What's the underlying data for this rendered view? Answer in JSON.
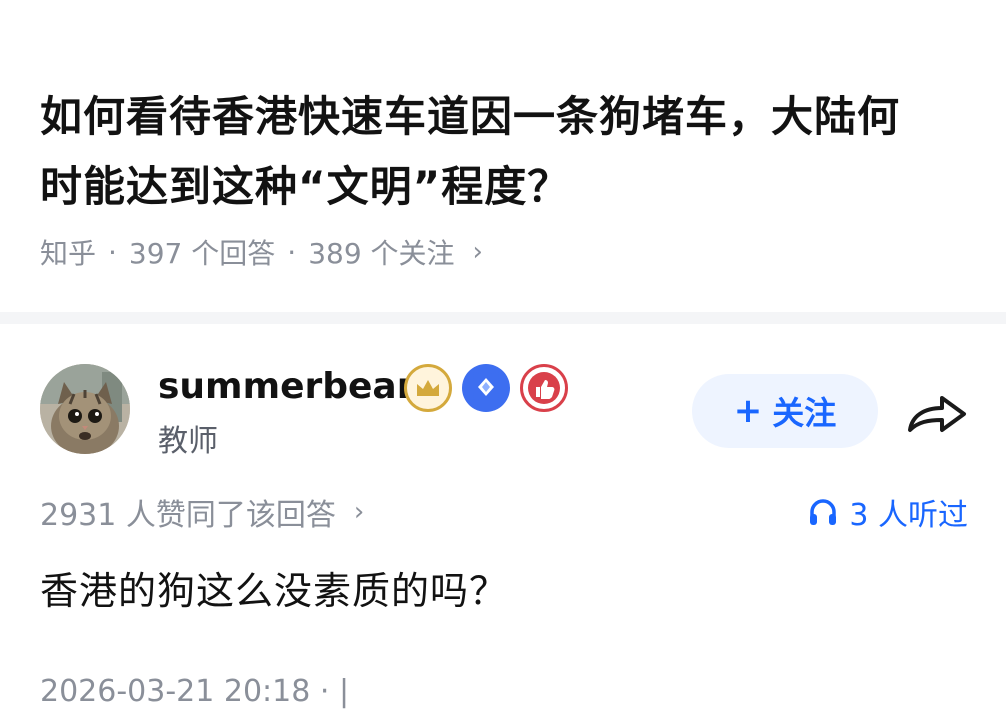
{
  "question": {
    "title": "如何看待香港快速车道因一条狗堵车，大陆何时能达到这种“文明”程度？",
    "source": "知乎",
    "separator": "·",
    "answers_count": "397 个回答",
    "followers_count": "389 个关注",
    "chevron": "›"
  },
  "answer": {
    "author": {
      "name": "summerbear",
      "title": "教师",
      "avatar_icon": "cat-avatar-icon",
      "badges": [
        "crown-badge-icon",
        "diamond-badge-icon",
        "thumbs-up-badge-icon"
      ]
    },
    "follow_button": {
      "plus": "+",
      "label": "关注"
    },
    "share_icon": "share-arrow-icon",
    "upvotes": "2931 人赞同了该回答",
    "upvotes_chevron": "›",
    "listen": {
      "icon": "headphones-icon",
      "label": "3 人听过"
    },
    "content": "香港的狗这么没素质的吗？",
    "timestamp": "2026-03-21 20:18 · |"
  },
  "colors": {
    "accent": "#1966ff",
    "follow_bg": "#eef4ff",
    "meta_gray": "#8a8f99",
    "divider": "#f4f5f7",
    "badge_gold": "#d4a93c",
    "badge_blue": "#3d6ef0",
    "badge_red": "#d9404a"
  }
}
